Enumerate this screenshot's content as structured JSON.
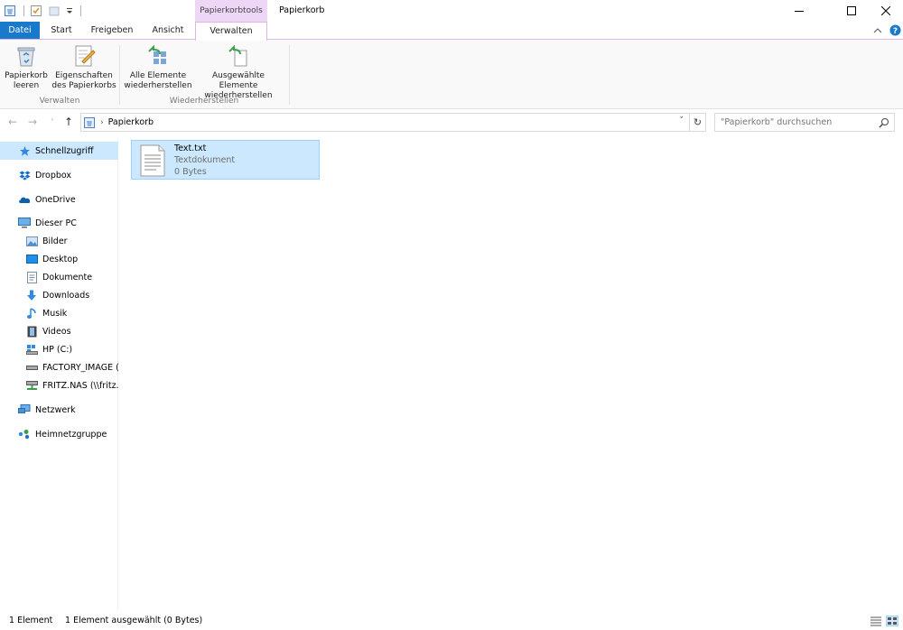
{
  "titlebar": {
    "context_tab_group": "Papierkorbtools",
    "window_title": "Papierkorb"
  },
  "tabs": {
    "file": "Datei",
    "start": "Start",
    "share": "Freigeben",
    "view": "Ansicht",
    "manage": "Verwalten"
  },
  "ribbon": {
    "empty_bin_line1": "Papierkorb",
    "empty_bin_line2": "leeren",
    "properties_line1": "Eigenschaften",
    "properties_line2": "des Papierkorbs",
    "group_manage": "Verwalten",
    "restore_all_line1": "Alle Elemente",
    "restore_all_line2": "wiederherstellen",
    "restore_selected_line1": "Ausgewählte Elemente",
    "restore_selected_line2": "wiederherstellen",
    "group_restore": "Wiederherstellen"
  },
  "address": {
    "path": "Papierkorb",
    "search_placeholder": "\"Papierkorb\" durchsuchen"
  },
  "nav": {
    "quick_access": "Schnellzugriff",
    "dropbox": "Dropbox",
    "onedrive": "OneDrive",
    "this_pc": "Dieser PC",
    "pictures": "Bilder",
    "desktop": "Desktop",
    "documents": "Dokumente",
    "downloads": "Downloads",
    "music": "Musik",
    "videos": "Videos",
    "drive_c": "HP (C:)",
    "drive_factory": "FACTORY_IMAGE (D",
    "drive_nas": "FRITZ.NAS (\\\\fritz.b",
    "network": "Netzwerk",
    "homegroup": "Heimnetzgruppe"
  },
  "files": [
    {
      "name": "Text.txt",
      "type": "Textdokument",
      "size": "0 Bytes"
    }
  ],
  "status": {
    "count": "1 Element",
    "selected": "1 Element ausgewählt (0 Bytes)"
  },
  "colors": {
    "accent": "#1979ca",
    "context_tab": "#eed6f6",
    "selection": "#cce8ff"
  }
}
